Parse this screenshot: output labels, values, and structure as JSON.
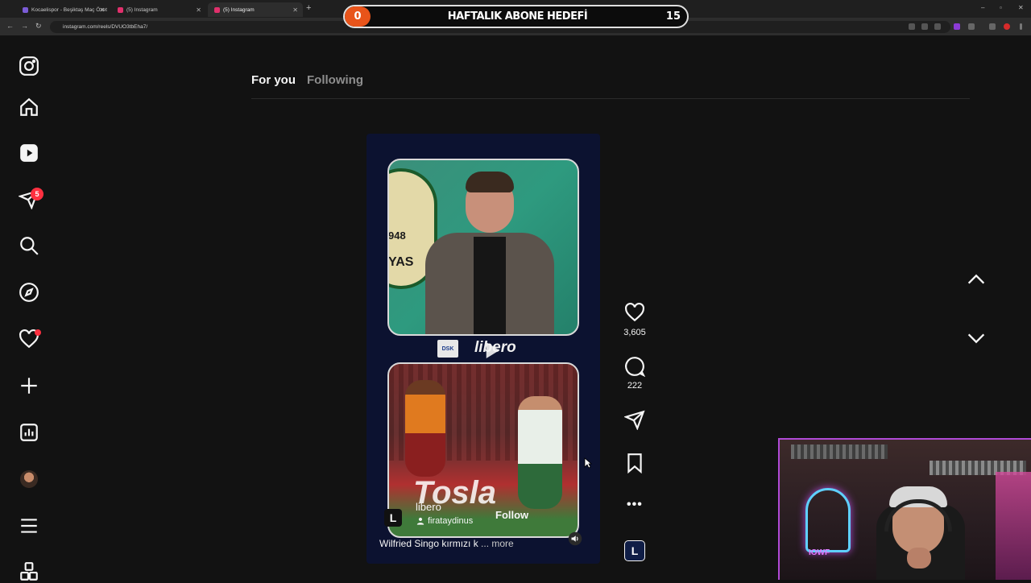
{
  "browser": {
    "tabs": [
      {
        "title": "Kocaelispor - Beşiktaş Maç Özet",
        "favicon_color": "#7b5cd6",
        "active": false
      },
      {
        "title": "(5) Instagram",
        "favicon_color": "#e1306c",
        "active": false
      },
      {
        "title": "(5) Instagram",
        "favicon_color": "#e1306c",
        "active": true
      }
    ],
    "new_tab": "+",
    "url": "instagram.com/reels/DVUO3tbEha7/"
  },
  "stream_overlay": {
    "count": "0",
    "title": "HAFTALIK ABONE HEDEFİ",
    "target": "15",
    "progress_fraction": 0
  },
  "sidebar": {
    "icons": [
      "instagram-logo-icon",
      "home-icon",
      "reels-icon",
      "messages-icon",
      "search-icon",
      "explore-icon",
      "notifications-icon",
      "create-icon",
      "dashboard-icon",
      "profile-avatar",
      "more-menu-icon",
      "meta-apps-icon"
    ],
    "messages_badge": "5"
  },
  "feed": {
    "tabs": {
      "for_you": "For you",
      "following": "Following"
    }
  },
  "reel": {
    "logo_year": "948",
    "logo_text": "YAS",
    "broadcaster": "DSK",
    "brand_word": "libero",
    "banner": "Tosla",
    "account_name": "libero",
    "account_logo": "L",
    "reposted_by": "firataydinus",
    "follow_label": "Follow",
    "caption": "Wilfried Singo kırmızı k",
    "caption_more": "... more"
  },
  "actions": {
    "likes": "3,605",
    "comments": "222",
    "audio_logo": "L"
  },
  "webcam": {
    "neon_text": "IOWF"
  }
}
